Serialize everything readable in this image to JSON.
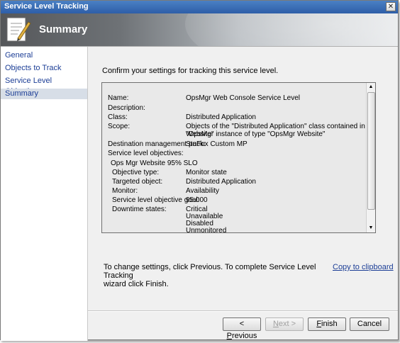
{
  "window": {
    "title": "Service Level Tracking",
    "close_glyph": "✕"
  },
  "header": {
    "title": "Summary",
    "icon": "document-pen-icon"
  },
  "nav": {
    "items": [
      {
        "label": "General"
      },
      {
        "label": "Objects to Track"
      },
      {
        "label": "Service Level Objectives"
      },
      {
        "label": "Summary",
        "selected": true
      }
    ]
  },
  "content": {
    "instruction": "Confirm your settings for tracking this service level.",
    "summary": {
      "name_label": "Name:",
      "name_value": "OpsMgr Web Console Service Level",
      "description_label": "Description:",
      "class_label": "Class:",
      "class_value": "Distributed Application",
      "scope_label": "Scope:",
      "scope_value_1": "Objects of the \"Distributed Application\" class contained in \"OpsMgr",
      "scope_value_2": "Website\" instance of type \"OpsMgr Website\"",
      "dest_label": "Destination management pack:",
      "dest_value": "StuFox Custom MP",
      "slo_label": "Service level objectives:",
      "slo_name": "Ops Mgr Website 95% SLO",
      "obj_type_label": "Objective type:",
      "obj_type_value": "Monitor state",
      "targeted_label": "Targeted object:",
      "targeted_value": "Distributed Application",
      "monitor_label": "Monitor:",
      "monitor_value": "Availability",
      "goal_label": "Service level objective goal:",
      "goal_value": "95.000",
      "downtime_label": "Downtime states:",
      "downtime_states": [
        "Critical",
        "Unavailable",
        "Disabled",
        "Unmonitored"
      ]
    },
    "footer_line_1": "To change settings, click Previous. To complete Service Level Tracking",
    "footer_line_2": "wizard click Finish.",
    "copy_link": "Copy to clipboard"
  },
  "buttons": {
    "previous_prefix": "< ",
    "previous_key": "P",
    "previous_rest": "revious",
    "next_key": "N",
    "next_rest": "ext >",
    "finish_key": "F",
    "finish_rest": "inish",
    "cancel": "Cancel"
  }
}
